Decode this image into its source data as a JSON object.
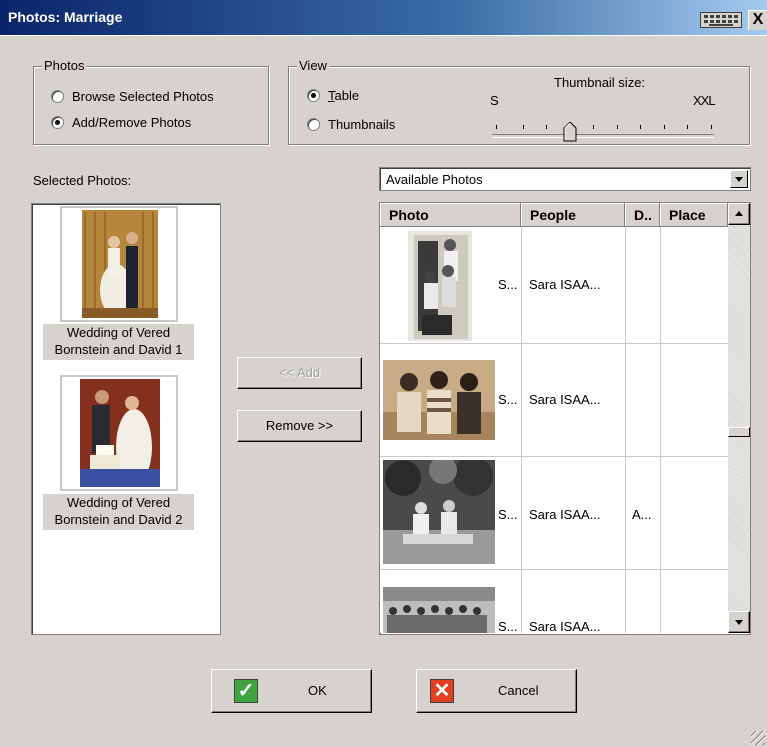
{
  "window": {
    "title": "Photos: Marriage",
    "close_glyph": "X"
  },
  "photos_group": {
    "legend": "Photos",
    "options": [
      {
        "label": "Browse Selected Photos",
        "checked": false
      },
      {
        "label": "Add/Remove Photos",
        "checked": true
      }
    ]
  },
  "view_group": {
    "legend": "View",
    "table_label_accel": "T",
    "table_label_rest": "able",
    "table_checked": true,
    "thumbnails_label": "Thumbnails",
    "thumbnails_checked": false,
    "thumbnail_size_label": "Thumbnail size:",
    "size_min": "S",
    "size_max": "XXL",
    "slider_position": 0.34
  },
  "selected": {
    "label": "Selected Photos:",
    "items": [
      {
        "caption_line1": "Wedding of Vered",
        "caption_line2": "Bornstein and David 1",
        "thumb": "wedding-couple-photo"
      },
      {
        "caption_line1": "Wedding of Vered",
        "caption_line2": "Bornstein and David 2",
        "thumb": "cake-cutting-photo"
      }
    ]
  },
  "buttons": {
    "add": "<< Add",
    "remove": "Remove >>",
    "ok": "OK",
    "cancel": "Cancel",
    "add_enabled": false
  },
  "available": {
    "combo_value": "Available Photos",
    "columns": [
      "Photo",
      "People",
      "D..",
      "Place"
    ],
    "rows": [
      {
        "photo_text": "S...",
        "people": "Sara ISAA...",
        "date": "",
        "place": ""
      },
      {
        "photo_text": "S...",
        "people": "Sara ISAA...",
        "date": "",
        "place": ""
      },
      {
        "photo_text": "S...",
        "people": "Sara ISAA...",
        "date": "A...",
        "place": ""
      },
      {
        "photo_text": "S...",
        "people": "Sara ISAA...",
        "date": "",
        "place": ""
      }
    ]
  },
  "colors": {
    "title_start": "#0a246a",
    "dialog_bg": "#d6d3ce",
    "ok_icon": "#3fa33f",
    "cancel_icon": "#e04020"
  },
  "icons": {
    "keyboard": "keyboard-icon",
    "ok": "checkmark-icon",
    "cancel": "x-icon"
  }
}
